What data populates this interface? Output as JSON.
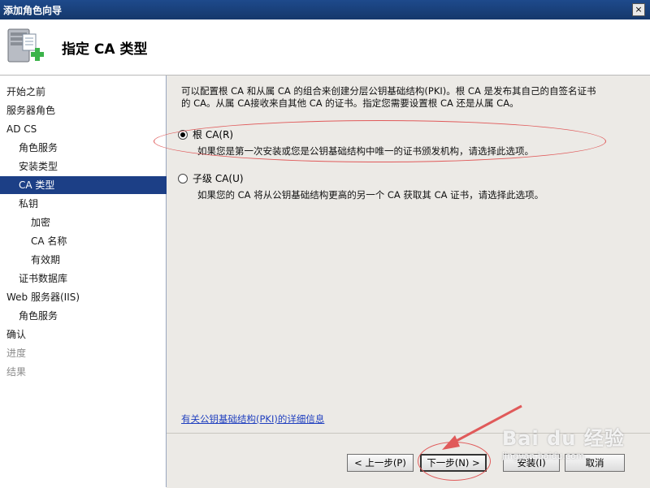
{
  "window": {
    "title": "添加角色向导",
    "close_glyph": "×"
  },
  "header": {
    "heading": "指定 CA 类型",
    "icon": "server-add-icon"
  },
  "sidebar": {
    "items": [
      {
        "label": "开始之前",
        "state": "normal"
      },
      {
        "label": "服务器角色",
        "state": "normal"
      },
      {
        "label": "AD CS",
        "state": "normal"
      },
      {
        "label": "角色服务",
        "state": "normal"
      },
      {
        "label": "安装类型",
        "state": "normal"
      },
      {
        "label": "CA 类型",
        "state": "active"
      },
      {
        "label": "私钥",
        "state": "normal"
      },
      {
        "label": "加密",
        "state": "normal"
      },
      {
        "label": "CA 名称",
        "state": "normal"
      },
      {
        "label": "有效期",
        "state": "normal"
      },
      {
        "label": "证书数据库",
        "state": "normal"
      },
      {
        "label": "Web 服务器(IIS)",
        "state": "normal"
      },
      {
        "label": "角色服务",
        "state": "normal"
      },
      {
        "label": "确认",
        "state": "normal"
      },
      {
        "label": "进度",
        "state": "dim"
      },
      {
        "label": "结果",
        "state": "dim"
      }
    ]
  },
  "main": {
    "intro_line1": "可以配置根 CA 和从属 CA 的组合来创建分层公钥基础结构(PKI)。根 CA 是发布其自己的自签名证书",
    "intro_line2": "的 CA。从属 CA接收来自其他 CA 的证书。指定您需要设置根 CA 还是从属 CA。",
    "options": [
      {
        "label": "根 CA(R)",
        "description": "如果您是第一次安装或您是公钥基础结构中唯一的证书颁发机构，请选择此选项。",
        "checked": true
      },
      {
        "label": "子级 CA(U)",
        "description": "如果您的 CA 将从公钥基础结构更高的另一个 CA 获取其 CA 证书，请选择此选项。",
        "checked": false
      }
    ],
    "more_info_link": "有关公钥基础结构(PKI)的详细信息"
  },
  "footer": {
    "back_label": "< 上一步(P)",
    "next_label": "下一步(N) >",
    "install_label": "安装(I)",
    "cancel_label": "取消"
  },
  "watermark": {
    "brand": "Bai du 经验",
    "url": "jingyan.baidu.com"
  },
  "colors": {
    "title_bar": "#1e4a8c",
    "sidebar_active": "#1c3f86",
    "annotation_red": "#e05a5a",
    "link": "#1f3fbf"
  }
}
